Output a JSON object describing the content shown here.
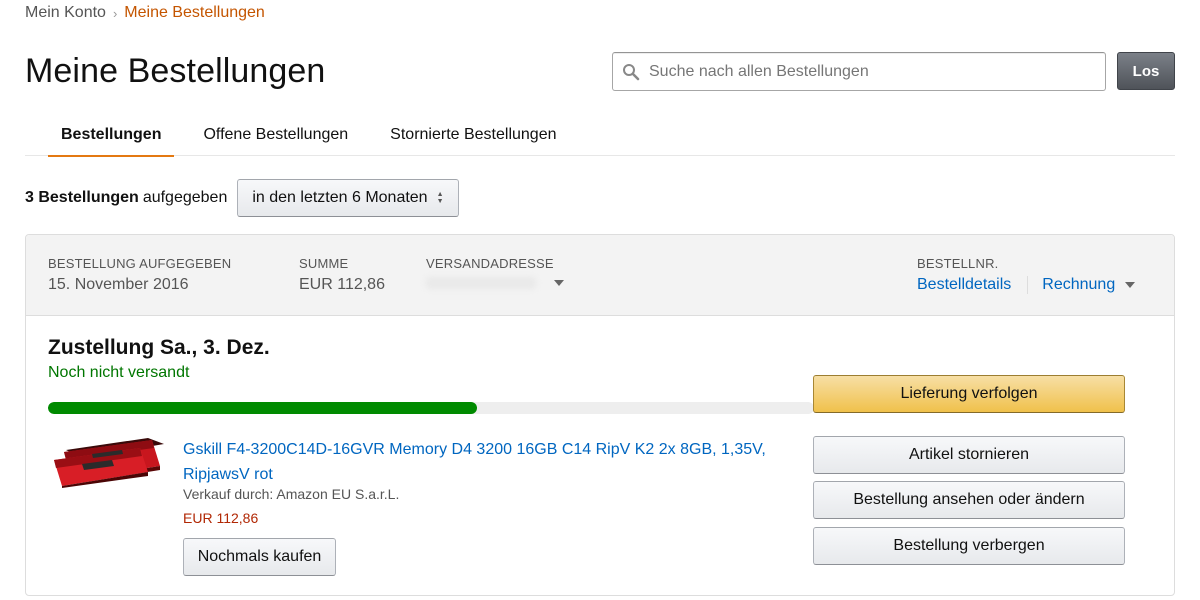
{
  "breadcrumb": {
    "parent": "Mein Konto",
    "separator": "›",
    "current": "Meine Bestellungen"
  },
  "page_title": "Meine Bestellungen",
  "search": {
    "placeholder": "Suche nach allen Bestellungen",
    "value": "",
    "button_label": "Los"
  },
  "tabs": [
    {
      "label": "Bestellungen",
      "active": true
    },
    {
      "label": "Offene Bestellungen",
      "active": false
    },
    {
      "label": "Stornierte Bestellungen",
      "active": false
    }
  ],
  "filter": {
    "count_text": "3 Bestellungen",
    "suffix": "aufgegeben",
    "period": "in den letzten 6 Monaten"
  },
  "order": {
    "placed_label": "BESTELLUNG AUFGEGEBEN",
    "placed_value": "15. November 2016",
    "total_label": "SUMME",
    "total_value": "EUR 112,86",
    "address_label": "VERSANDADRESSE",
    "order_no_label": "BESTELLNR.",
    "details_link": "Bestelldetails",
    "invoice_link": "Rechnung",
    "delivery_title": "Zustellung Sa., 3. Dez.",
    "status": "Noch nicht versandt",
    "progress": 0.56,
    "item": {
      "title": "Gskill F4-3200C14D-16GVR Memory D4 3200 16GB C14 RipV K2 2x 8GB, 1,35V, RipjawsV rot",
      "seller": "Verkauf durch: Amazon EU S.a.r.L.",
      "price": "EUR 112,86",
      "buy_again": "Nochmals kaufen"
    },
    "actions": {
      "track": "Lieferung verfolgen",
      "cancel": "Artikel stornieren",
      "view_edit": "Bestellung ansehen oder ändern",
      "hide": "Bestellung verbergen"
    }
  },
  "colors": {
    "accent": "#e47911",
    "link": "#0066c0",
    "status_green": "#007600",
    "price_red": "#b12704",
    "primary_button": "#f0c14b"
  }
}
